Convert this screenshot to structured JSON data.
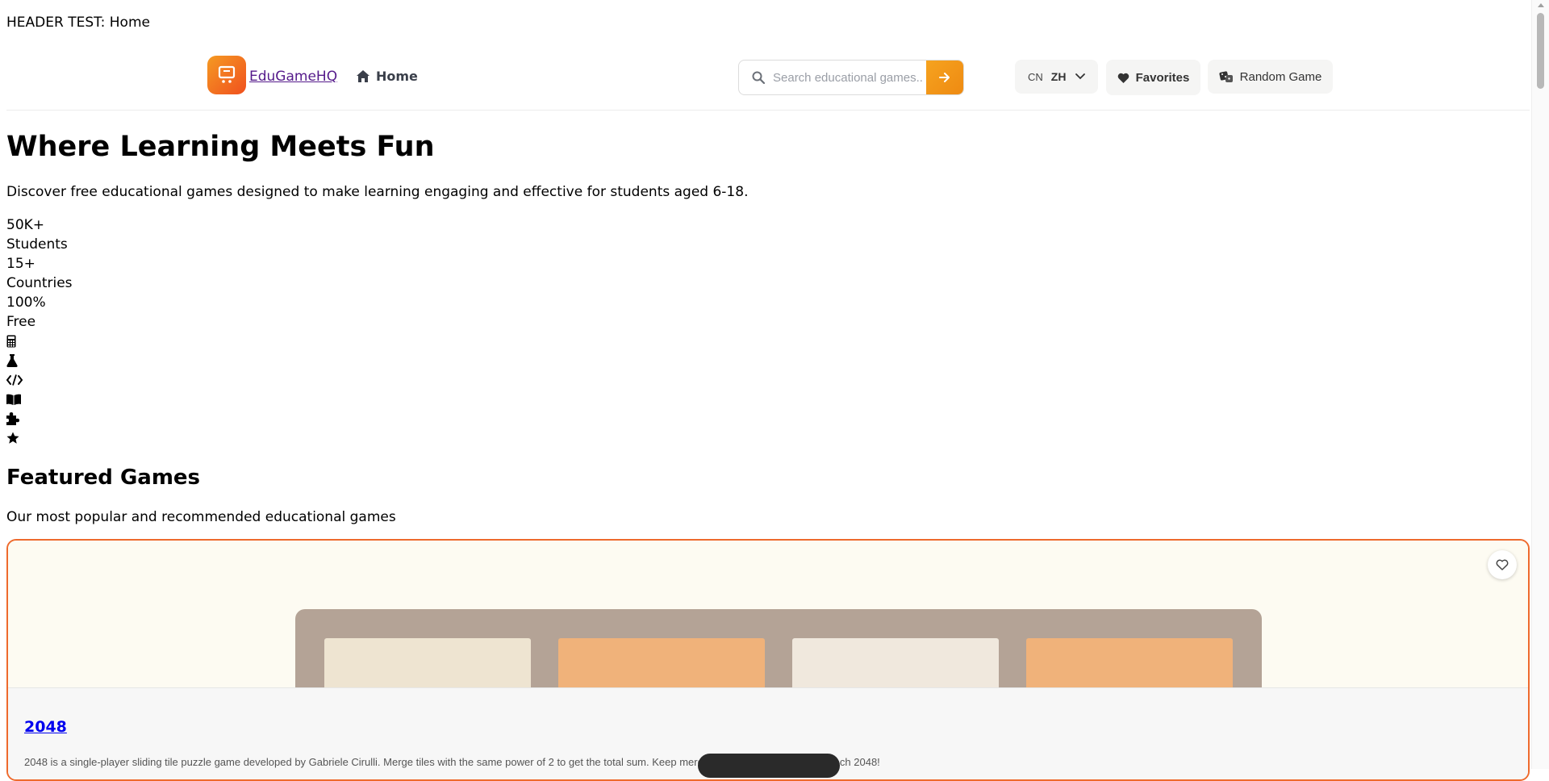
{
  "header_test": {
    "text": "HEADER TEST: Home"
  },
  "navbar": {
    "logo_text": "EduGameHQ",
    "home_label": "Home",
    "search": {
      "placeholder": "Search educational games..."
    },
    "language": {
      "code": "CN",
      "label": "ZH"
    },
    "favorites_label": "Favorites",
    "random_label": "Random Game"
  },
  "hero": {
    "title": "Where Learning Meets Fun",
    "subtitle": "Discover free educational games designed to make learning engaging and effective for students aged 6-18.",
    "stats": [
      {
        "value": "50K+",
        "label": "Students"
      },
      {
        "value": "15+",
        "label": "Countries"
      },
      {
        "value": "100%",
        "label": "Free"
      }
    ],
    "category_icons": [
      "calculator-icon",
      "flask-icon",
      "code-icon",
      "book-icon",
      "puzzle-icon",
      "star-icon"
    ]
  },
  "featured": {
    "title": "Featured Games",
    "subtitle": "Our most popular and recommended educational games",
    "games": [
      {
        "title": "2048",
        "description": "2048 is a single-player sliding tile puzzle game developed by Gabriele Cirulli. Merge tiles with the same power of 2 to get the total sum. Keep merging tiles this way until you reach 2048!"
      }
    ]
  },
  "colors": {
    "accent_orange": "#f0501e",
    "search_button": "#ee8a12",
    "card_border": "#ee6a2d",
    "link_visited": "#551a8b",
    "link": "#0000ee"
  }
}
